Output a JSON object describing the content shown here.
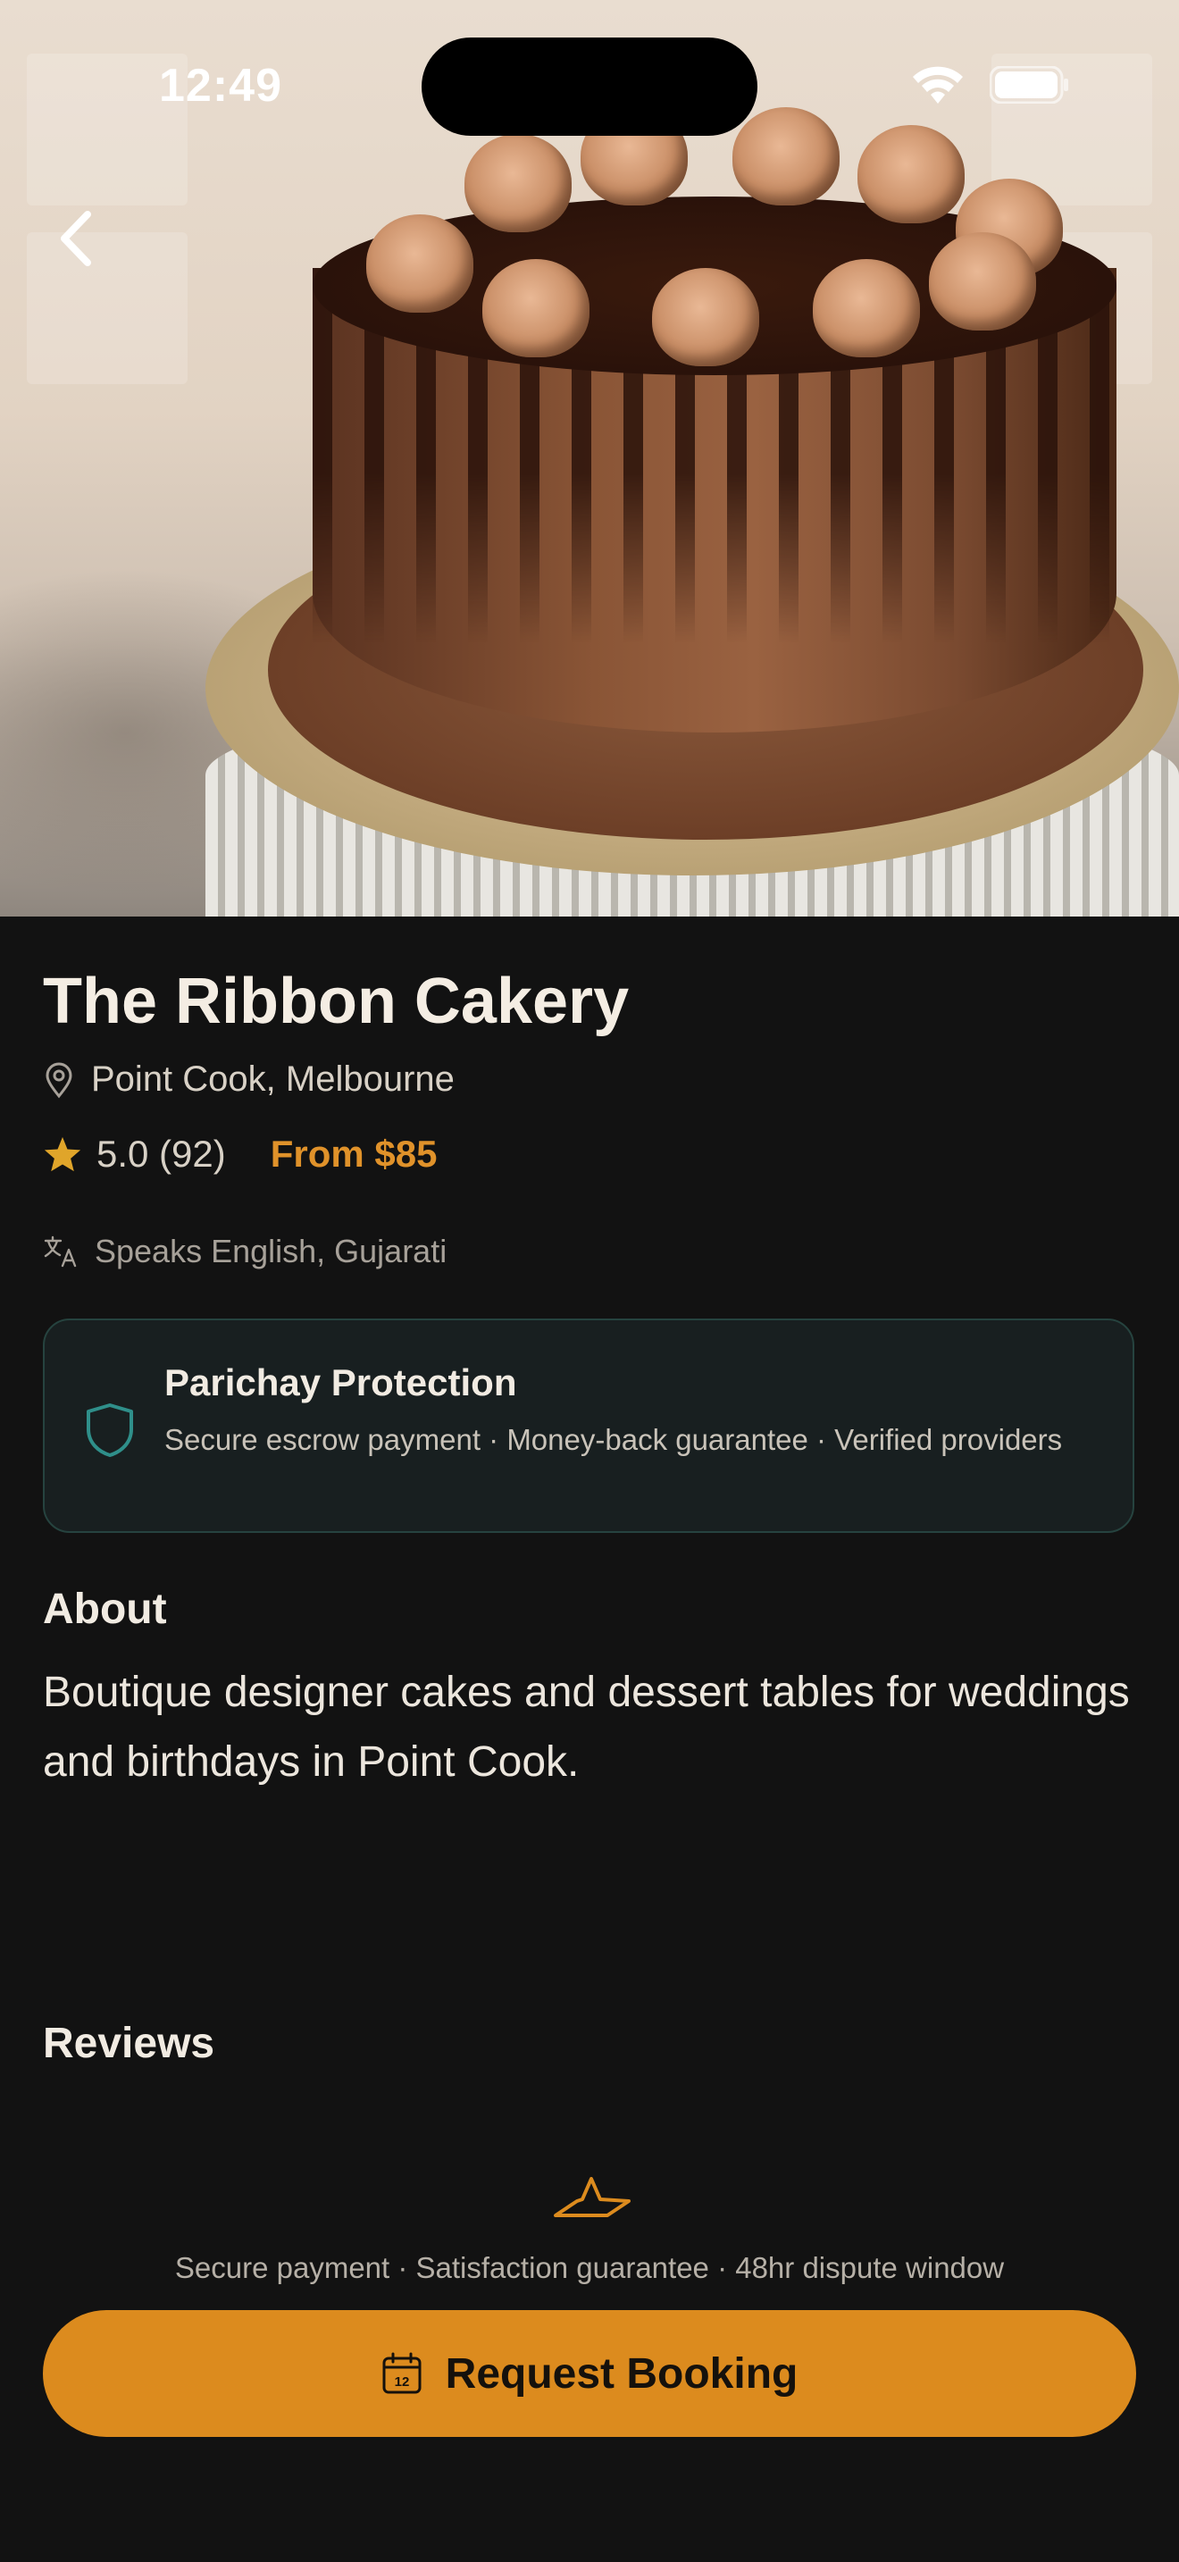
{
  "status_bar": {
    "time": "12:49"
  },
  "vendor": {
    "name": "The Ribbon Cakery",
    "location": "Point Cook, Melbourne",
    "rating": "5.0 (92)",
    "price": "From $85",
    "languages": "Speaks English, Gujarati"
  },
  "protection": {
    "title": "Parichay Protection",
    "description": "Secure escrow payment · Money-back guarantee · Verified providers"
  },
  "about": {
    "heading": "About",
    "text": "Boutique designer cakes and dessert tables for weddings and birthdays in Point Cook."
  },
  "reviews": {
    "heading": "Reviews"
  },
  "footer": {
    "trust_line": "Secure payment · Satisfaction guarantee · 48hr dispute window",
    "book_label": "Request Booking",
    "calendar_day": "12"
  },
  "colors": {
    "background": "#121212",
    "accent": "#dc8b1e",
    "price": "#e0922a",
    "protection_border": "#26433f",
    "protection_icon": "#2f8f8a"
  }
}
